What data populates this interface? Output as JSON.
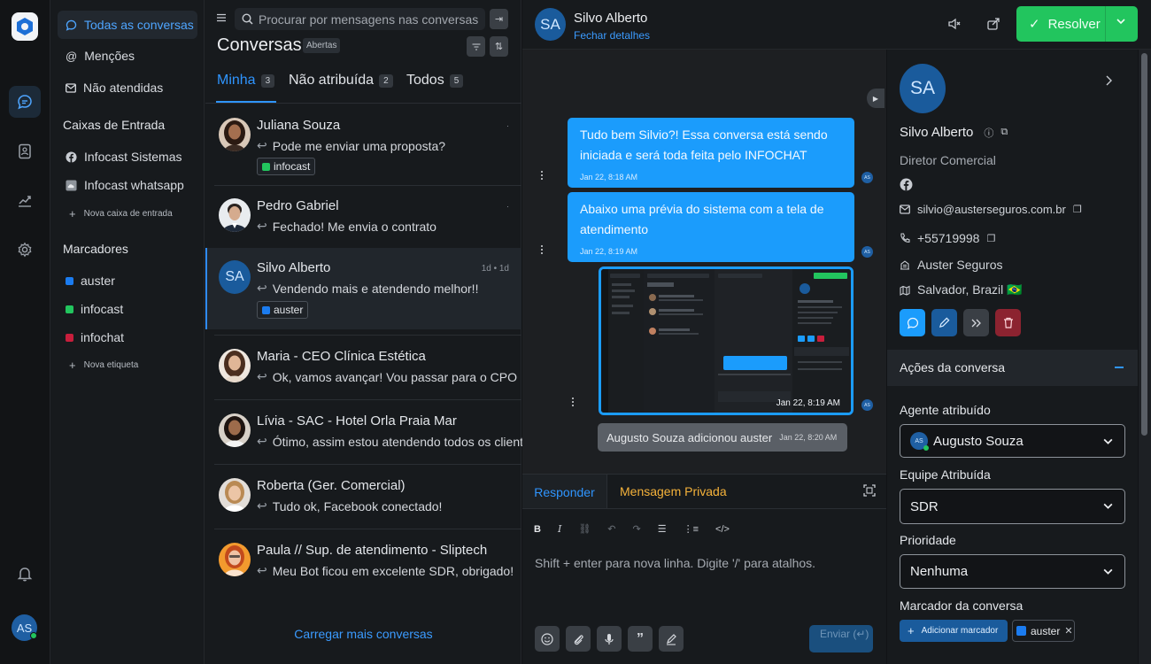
{
  "rail": {
    "avatar": "AS"
  },
  "sidebar": {
    "items": [
      {
        "label": "Todas as conversas",
        "icon": "chat-bubble-icon"
      },
      {
        "label": "Menções",
        "icon": "at-icon"
      },
      {
        "label": "Não atendidas",
        "icon": "envelope-icon"
      }
    ],
    "inbox_title": "Caixas de Entrada",
    "inboxes": [
      {
        "label": "Infocast Sistemas",
        "icon": "facebook-icon"
      },
      {
        "label": "Infocast whatsapp",
        "icon": "cloud-icon"
      }
    ],
    "add_inbox": "Nova caixa de entrada",
    "labels_title": "Marcadores",
    "labels": [
      {
        "label": "auster",
        "color": "#1b7cf0"
      },
      {
        "label": "infocast",
        "color": "#22c55e"
      },
      {
        "label": "infochat",
        "color": "#c81e3c"
      }
    ],
    "add_label": "Nova etiqueta"
  },
  "list": {
    "search_placeholder": "Procurar por mensagens nas conversas",
    "title": "Conversas",
    "status_badge": "Abertas",
    "tabs": [
      {
        "label": "Minha",
        "count": "3"
      },
      {
        "label": "Não atribuída",
        "count": "2"
      },
      {
        "label": "Todos",
        "count": "5"
      }
    ],
    "conversations": [
      {
        "name": "Juliana Souza",
        "message": "Pode me enviar uma proposta?",
        "label": "infocast",
        "label_color": "#22c55e",
        "time": ""
      },
      {
        "name": "Pedro Gabriel",
        "message": "Fechado! Me envia o contrato",
        "label": "",
        "time": ""
      },
      {
        "name": "Silvo Alberto",
        "message": "Vendendo mais e atendendo melhor!!",
        "label": "auster",
        "label_color": "#1b7cf0",
        "time": "1d • 1d",
        "initials": "SA"
      },
      {
        "name": "Maria - CEO Clínica Estética",
        "message": "Ok, vamos avançar! Vou passar para o CPO",
        "label": "",
        "time": ""
      },
      {
        "name": "Lívia - SAC - Hotel Orla Praia Mar",
        "message": "Ótimo, assim estou atendendo todos os clientes",
        "label": "",
        "time": ""
      },
      {
        "name": "Roberta (Ger. Comercial)",
        "message": "Tudo ok, Facebook conectado!",
        "label": "",
        "time": ""
      },
      {
        "name": "Paula // Sup. de atendimento - Sliptech",
        "message": "Meu Bot ficou em excelente SDR, obrigado!",
        "label": "",
        "time": ""
      }
    ],
    "load_more": "Carregar mais conversas"
  },
  "chat": {
    "contact_initials": "SA",
    "contact_name": "Silvo Alberto",
    "close_details": "Fechar detalhes",
    "resolve": "Resolver",
    "messages": [
      {
        "text": "Tudo bem Silvio?! Essa conversa está sendo iniciada e será toda feita pelo INFOCHAT",
        "time": "Jan 22, 8:18 AM"
      },
      {
        "text": "Abaixo uma prévia do sistema com a tela de atendimento",
        "time": "Jan 22, 8:19 AM"
      }
    ],
    "image_time": "Jan 22, 8:19 AM",
    "sender_initials": "AS",
    "activity": "Augusto Souza adicionou auster",
    "activity_time": "Jan 22, 8:20 AM",
    "reply_tab": "Responder",
    "private_tab": "Mensagem Privada",
    "composer_placeholder": "Shift + enter para nova linha. Digite '/' para atalhos.",
    "send": "Enviar (↵)"
  },
  "details": {
    "initials": "SA",
    "name": "Silvo Alberto",
    "role": "Diretor Comercial",
    "email": "silvio@austerseguros.com.br",
    "phone": "+55719998",
    "company": "Auster Seguros",
    "location": "Salvador, Brazil 🇧🇷",
    "actions_title": "Ações da conversa",
    "agent_label": "Agente atribuído",
    "agent_initials": "AS",
    "agent_value": "Augusto Souza",
    "team_label": "Equipe Atribuída",
    "team_value": "SDR",
    "priority_label": "Prioridade",
    "priority_value": "Nenhuma",
    "tags_label": "Marcador da conversa",
    "add_tag": "Adicionar marcador",
    "tag": "auster"
  }
}
